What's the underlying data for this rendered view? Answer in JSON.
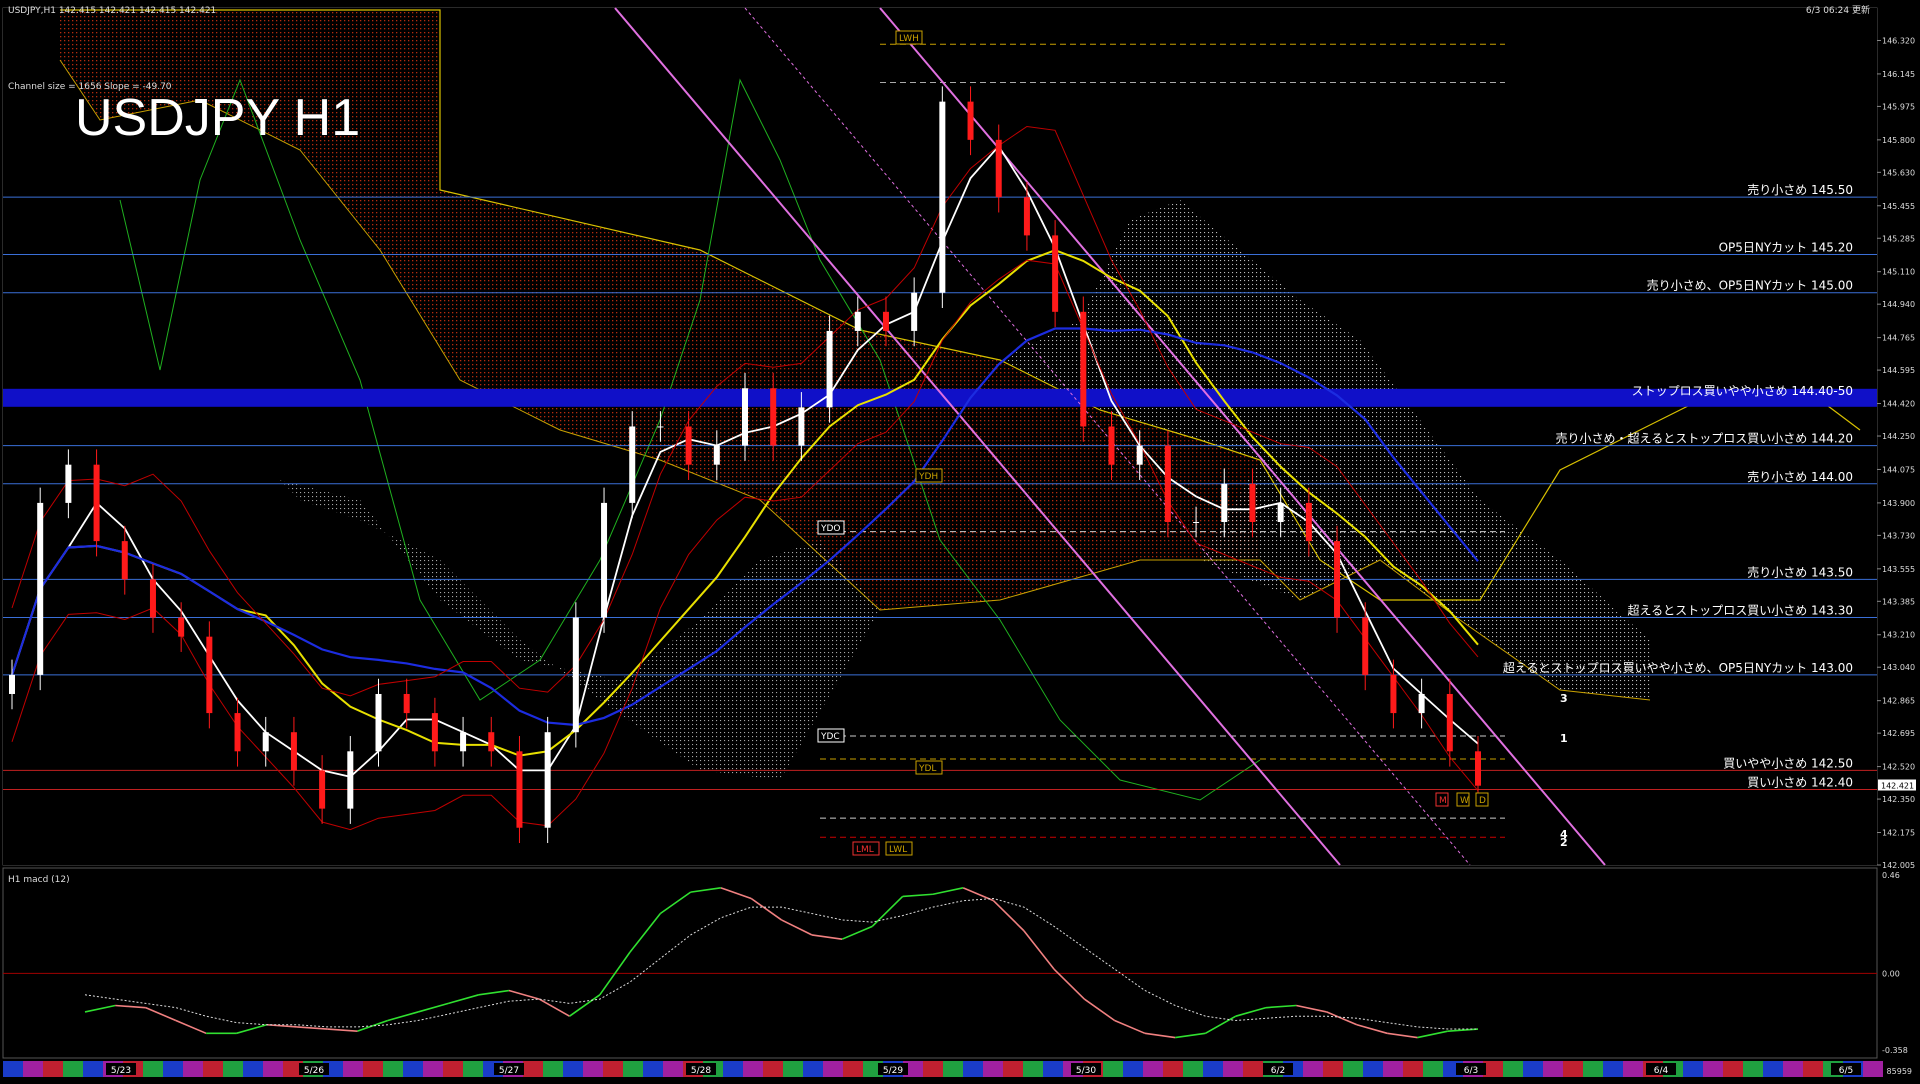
{
  "window": {
    "symbol_info": "USDJPY,H1  142.415 142.421 142.415 142.421",
    "channel_info": "Channel size = 1656  Slope = -49.70",
    "big_title": "USDJPY H1",
    "updated": "6/3 06:24 更新",
    "price_tag": "142.421",
    "footer_right": "85959"
  },
  "colors": {
    "background": "#000000",
    "bull_candle": "#ffffff",
    "bear_candle": "#ff1a1a",
    "level_line": "#3a6fd8",
    "stop_band": "#1010c8",
    "sma_white": "#ffffff",
    "sma_yellow": "#e8e000",
    "sma_blue": "#1c2ce0",
    "channel": "#e070e0",
    "cloud_red": "#c83010",
    "cloud_white": "#d0d0d0",
    "macd_up": "#30e030",
    "macd_down": "#f08080"
  },
  "chart_data": {
    "type": "candlestick",
    "ylim": [
      142.005,
      146.49
    ],
    "y_ticks": [
      "146.320",
      "146.145",
      "145.975",
      "145.800",
      "145.630",
      "145.455",
      "145.285",
      "145.110",
      "144.940",
      "144.765",
      "144.595",
      "144.420",
      "144.250",
      "144.075",
      "143.900",
      "143.730",
      "143.555",
      "143.385",
      "143.210",
      "143.040",
      "142.865",
      "142.695",
      "142.520",
      "142.350",
      "142.175",
      "142.005"
    ],
    "x_day_labels": [
      "5/23",
      "5/26",
      "5/27",
      "5/28",
      "5/29",
      "5/30",
      "6/2",
      "6/3",
      "6/4",
      "6/5"
    ],
    "price_series": [
      143.0,
      143.9,
      144.1,
      143.7,
      143.5,
      143.3,
      143.2,
      142.8,
      142.6,
      142.7,
      142.5,
      142.3,
      142.6,
      142.9,
      142.8,
      142.6,
      142.7,
      142.6,
      142.2,
      142.7,
      143.3,
      143.9,
      144.3,
      144.3,
      144.1,
      144.2,
      144.5,
      144.2,
      144.4,
      144.8,
      144.9,
      144.8,
      145.0,
      146.0,
      145.8,
      145.5,
      145.3,
      144.9,
      144.3,
      144.1,
      144.2,
      143.8,
      143.8,
      144.0,
      143.8,
      143.9,
      143.7,
      143.3,
      143.0,
      142.8,
      142.9,
      142.6,
      142.42
    ],
    "levels": [
      {
        "label": "売り小さめ 145.50",
        "value": 145.5
      },
      {
        "label": "OP5日NYカット 145.20",
        "value": 145.2
      },
      {
        "label": "売り小さめ、OP5日NYカット 145.00",
        "value": 145.0
      },
      {
        "label": "ストップロス買いやや小さめ 144.40-50",
        "value": 144.45
      },
      {
        "label": "売り小さめ・超えるとストップロス買い小さめ 144.20",
        "value": 144.2
      },
      {
        "label": "売り小さめ 144.00",
        "value": 144.0
      },
      {
        "label": "売り小さめ 143.50",
        "value": 143.5
      },
      {
        "label": "超えるとストップロス買い小さめ 143.30",
        "value": 143.3
      },
      {
        "label": "超えるとストップロス買いやや小さめ、OP5日NYカット 143.00",
        "value": 143.0
      },
      {
        "label": "買いやや小さめ 142.50",
        "value": 142.5
      },
      {
        "label": "買い小さめ 142.40",
        "value": 142.4
      }
    ],
    "markers": [
      "LWH",
      "YDH",
      "YDO",
      "YDC",
      "YDL",
      "LML",
      "LWL",
      "M",
      "W",
      "D"
    ],
    "projection_labels": [
      "3",
      "1",
      "4",
      "2"
    ],
    "macd": {
      "title": "H1  macd (12)",
      "ticks": [
        "0.46",
        "0.00",
        "-0.358"
      ],
      "ylim": [
        -0.358,
        0.46
      ],
      "main": [
        -0.18,
        -0.15,
        -0.16,
        -0.22,
        -0.28,
        -0.28,
        -0.24,
        -0.25,
        -0.26,
        -0.27,
        -0.22,
        -0.18,
        -0.14,
        -0.1,
        -0.08,
        -0.12,
        -0.2,
        -0.1,
        0.1,
        0.28,
        0.38,
        0.4,
        0.35,
        0.25,
        0.18,
        0.16,
        0.22,
        0.36,
        0.37,
        0.4,
        0.34,
        0.2,
        0.02,
        -0.12,
        -0.22,
        -0.28,
        -0.3,
        -0.28,
        -0.2,
        -0.16,
        -0.15,
        -0.18,
        -0.24,
        -0.28,
        -0.3,
        -0.27,
        -0.26
      ],
      "signal": [
        -0.1,
        -0.12,
        -0.14,
        -0.16,
        -0.2,
        -0.23,
        -0.24,
        -0.24,
        -0.25,
        -0.25,
        -0.24,
        -0.22,
        -0.19,
        -0.16,
        -0.13,
        -0.12,
        -0.14,
        -0.12,
        -0.04,
        0.07,
        0.18,
        0.26,
        0.31,
        0.31,
        0.28,
        0.25,
        0.24,
        0.27,
        0.31,
        0.34,
        0.35,
        0.31,
        0.22,
        0.12,
        0.02,
        -0.08,
        -0.15,
        -0.2,
        -0.22,
        -0.21,
        -0.2,
        -0.2,
        -0.21,
        -0.23,
        -0.25,
        -0.26,
        -0.26
      ]
    }
  }
}
